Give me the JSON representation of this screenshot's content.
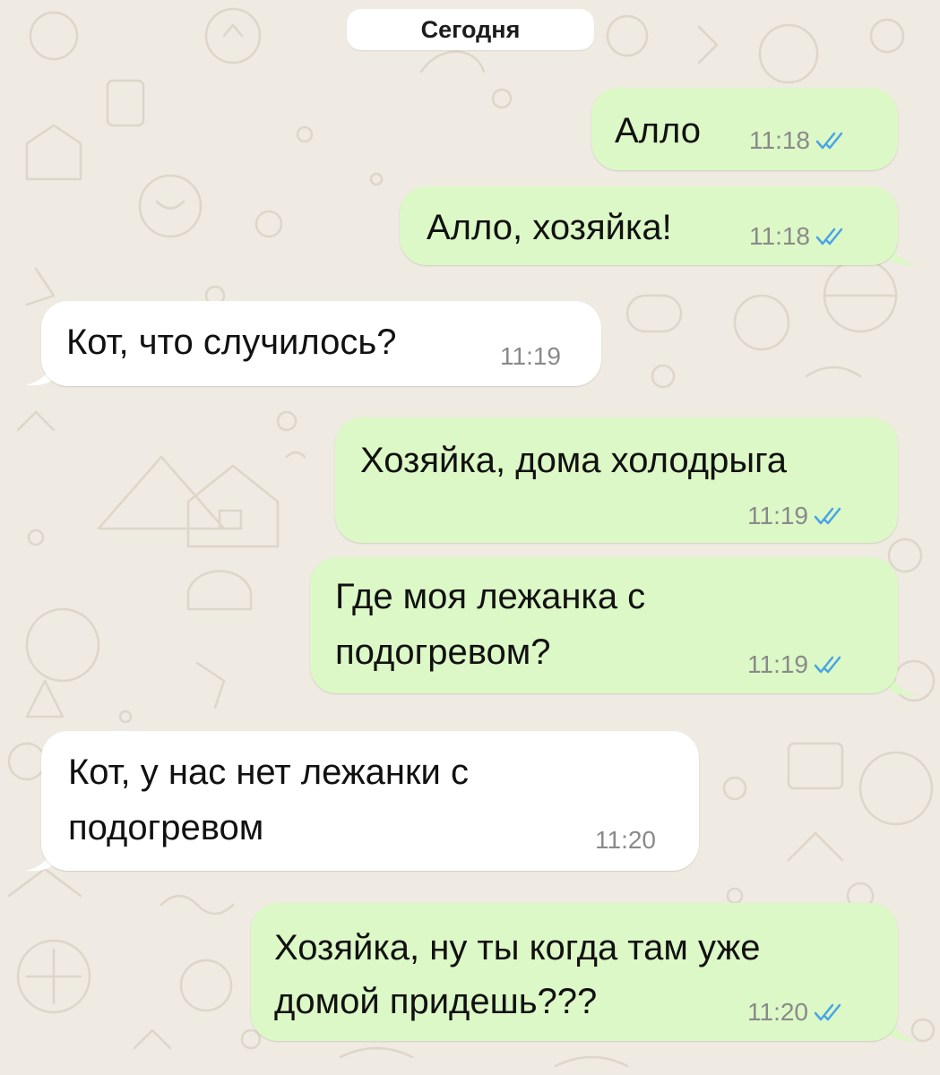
{
  "date_separator": "Сегодня",
  "colors": {
    "outgoing_bubble": "#dcf8c6",
    "incoming_bubble": "#ffffff",
    "background": "#efeae2",
    "read_ticks": "#4aa3e6",
    "timestamp": "#8a8a8a"
  },
  "messages": [
    {
      "direction": "out",
      "text": "Алло",
      "time": "11:18",
      "status": "read"
    },
    {
      "direction": "out",
      "text": "Алло, хозяйка!",
      "time": "11:18",
      "status": "read"
    },
    {
      "direction": "in",
      "text": "Кот, что случилось?",
      "time": "11:19"
    },
    {
      "direction": "out",
      "text": "Хозяйка, дома холодрыга",
      "time": "11:19",
      "status": "read"
    },
    {
      "direction": "out",
      "text_lines": [
        "Где моя лежанка с",
        "подогревом?"
      ],
      "time": "11:19",
      "status": "read"
    },
    {
      "direction": "in",
      "text_lines": [
        "Кот, у нас нет лежанки с",
        "подогревом"
      ],
      "time": "11:20"
    },
    {
      "direction": "out",
      "text_lines": [
        "Хозяйка, ну ты когда там уже",
        "домой придешь???"
      ],
      "time": "11:20",
      "status": "read"
    }
  ]
}
